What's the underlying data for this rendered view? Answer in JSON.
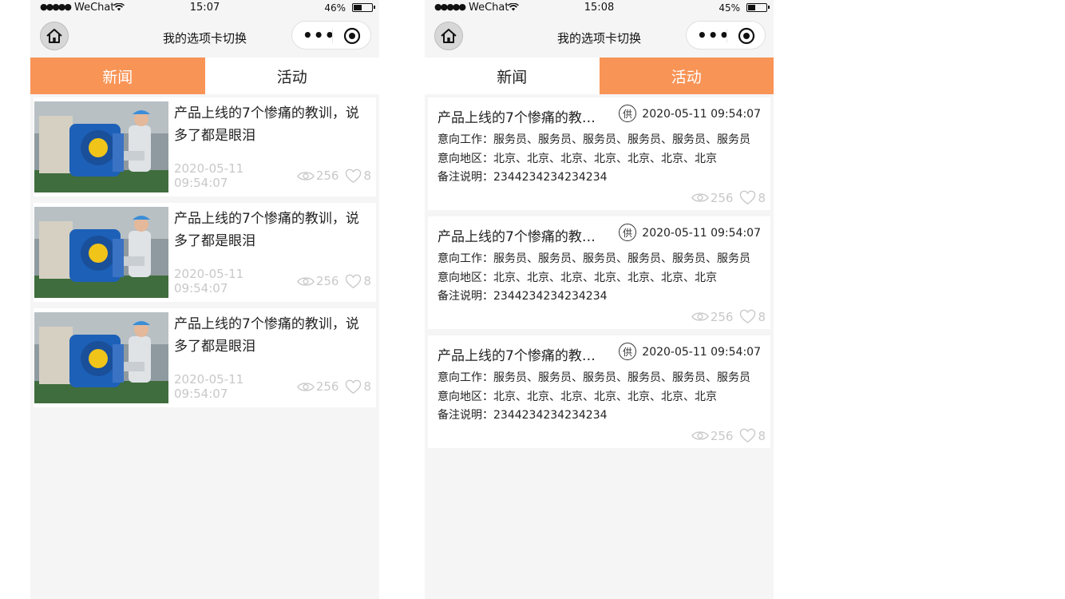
{
  "colors": {
    "accent": "#f89456",
    "page_bg": "#f5f5f5",
    "muted": "#c8c8c8"
  },
  "left": {
    "status": {
      "carrier": "WeChat",
      "time": "15:07",
      "battery": "46%",
      "battery_level": 0.46
    },
    "nav": {
      "title": "我的选项卡切换",
      "home_icon": "home-icon",
      "more_icon": "more-dots-icon",
      "close_icon": "target-icon"
    },
    "tabs": [
      {
        "label": "新闻",
        "active": true
      },
      {
        "label": "活动",
        "active": false
      }
    ],
    "news": [
      {
        "title": "产品上线的7个惨痛的教训，说多了都是眼泪",
        "date": "2020-05-11 09:54:07",
        "views": "256",
        "likes": "8"
      },
      {
        "title": "产品上线的7个惨痛的教训，说多了都是眼泪",
        "date": "2020-05-11 09:54:07",
        "views": "256",
        "likes": "8"
      },
      {
        "title": "产品上线的7个惨痛的教训，说多了都是眼泪",
        "date": "2020-05-11 09:54:07",
        "views": "256",
        "likes": "8"
      }
    ]
  },
  "right": {
    "status": {
      "carrier": "WeChat",
      "time": "15:08",
      "battery": "45%",
      "battery_level": 0.45
    },
    "nav": {
      "title": "我的选项卡切换",
      "home_icon": "home-icon",
      "more_icon": "more-dots-icon",
      "close_icon": "target-icon"
    },
    "tabs": [
      {
        "label": "新闻",
        "active": false
      },
      {
        "label": "活动",
        "active": true
      }
    ],
    "jobs": [
      {
        "title": "产品上线的7个惨痛的教训...",
        "badge": "供",
        "date": "2020-05-11 09:54:07",
        "job": "意向工作：服务员、服务员、服务员、服务员、服务员、服务员",
        "area": "意向地区：北京、北京、北京、北京、北京、北京、北京",
        "note": "备注说明：2344234234234234",
        "views": "256",
        "likes": "8"
      },
      {
        "title": "产品上线的7个惨痛的教训...",
        "badge": "供",
        "date": "2020-05-11 09:54:07",
        "job": "意向工作：服务员、服务员、服务员、服务员、服务员、服务员",
        "area": "意向地区：北京、北京、北京、北京、北京、北京、北京",
        "note": "备注说明：2344234234234234",
        "views": "256",
        "likes": "8"
      },
      {
        "title": "产品上线的7个惨痛的教训...",
        "badge": "供",
        "date": "2020-05-11 09:54:07",
        "job": "意向工作：服务员、服务员、服务员、服务员、服务员、服务员",
        "area": "意向地区：北京、北京、北京、北京、北京、北京、北京",
        "note": "备注说明：2344234234234234",
        "views": "256",
        "likes": "8"
      }
    ]
  }
}
